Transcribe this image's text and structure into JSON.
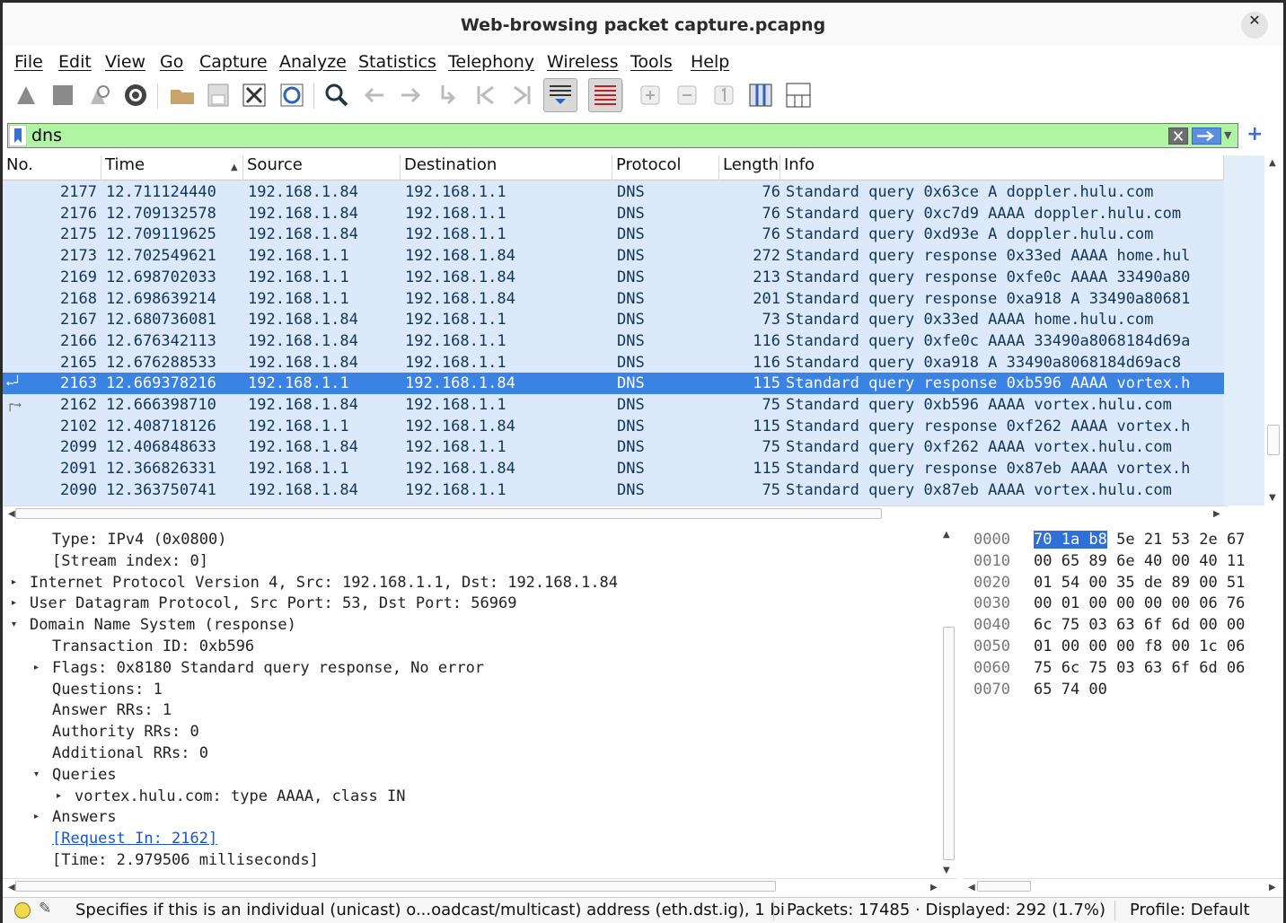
{
  "window": {
    "title": "Web-browsing packet capture.pcapng",
    "close_glyph": "✕"
  },
  "menu": [
    {
      "label": "File"
    },
    {
      "label": "Edit"
    },
    {
      "label": "View"
    },
    {
      "label": "Go"
    },
    {
      "label": "Capture"
    },
    {
      "label": "Analyze"
    },
    {
      "label": "Statistics"
    },
    {
      "label": "Telephony"
    },
    {
      "label": "Wireless"
    },
    {
      "label": "Tools"
    },
    {
      "label": "Help"
    }
  ],
  "toolbar": {
    "icons": [
      "start-capture-icon",
      "stop-capture-icon",
      "restart-capture-icon",
      "capture-options-icon",
      "open-file-icon",
      "save-file-icon",
      "close-file-icon",
      "reload-file-icon",
      "find-packet-icon",
      "go-back-icon",
      "go-forward-icon",
      "go-to-packet-icon",
      "first-packet-icon",
      "last-packet-icon",
      "autoscroll-icon",
      "colorize-icon",
      "zoom-in-icon",
      "zoom-out-icon",
      "normal-size-icon",
      "resize-columns-icon",
      "layout-icon"
    ]
  },
  "filter": {
    "value": "dns",
    "plus": "+"
  },
  "packet_list": {
    "columns": [
      "No.",
      "Time",
      "Source",
      "Destination",
      "Protocol",
      "Length",
      "Info"
    ],
    "rows": [
      {
        "no": "2177",
        "time": "12.711124440",
        "src": "192.168.1.84",
        "dst": "192.168.1.1",
        "proto": "DNS",
        "len": "76",
        "info": "Standard query 0x63ce A doppler.hulu.com"
      },
      {
        "no": "2176",
        "time": "12.709132578",
        "src": "192.168.1.84",
        "dst": "192.168.1.1",
        "proto": "DNS",
        "len": "76",
        "info": "Standard query 0xc7d9 AAAA doppler.hulu.com"
      },
      {
        "no": "2175",
        "time": "12.709119625",
        "src": "192.168.1.84",
        "dst": "192.168.1.1",
        "proto": "DNS",
        "len": "76",
        "info": "Standard query 0xd93e A doppler.hulu.com"
      },
      {
        "no": "2173",
        "time": "12.702549621",
        "src": "192.168.1.1",
        "dst": "192.168.1.84",
        "proto": "DNS",
        "len": "272",
        "info": "Standard query response 0x33ed AAAA home.hul"
      },
      {
        "no": "2169",
        "time": "12.698702033",
        "src": "192.168.1.1",
        "dst": "192.168.1.84",
        "proto": "DNS",
        "len": "213",
        "info": "Standard query response 0xfe0c AAAA 33490a80"
      },
      {
        "no": "2168",
        "time": "12.698639214",
        "src": "192.168.1.1",
        "dst": "192.168.1.84",
        "proto": "DNS",
        "len": "201",
        "info": "Standard query response 0xa918 A 33490a80681"
      },
      {
        "no": "2167",
        "time": "12.680736081",
        "src": "192.168.1.84",
        "dst": "192.168.1.1",
        "proto": "DNS",
        "len": "73",
        "info": "Standard query 0x33ed AAAA home.hulu.com"
      },
      {
        "no": "2166",
        "time": "12.676342113",
        "src": "192.168.1.84",
        "dst": "192.168.1.1",
        "proto": "DNS",
        "len": "116",
        "info": "Standard query 0xfe0c AAAA 33490a8068184d69a"
      },
      {
        "no": "2165",
        "time": "12.676288533",
        "src": "192.168.1.84",
        "dst": "192.168.1.1",
        "proto": "DNS",
        "len": "116",
        "info": "Standard query 0xa918 A 33490a8068184d69ac8"
      },
      {
        "no": "2163",
        "time": "12.669378216",
        "src": "192.168.1.1",
        "dst": "192.168.1.84",
        "proto": "DNS",
        "len": "115",
        "info": "Standard query response 0xb596 AAAA vortex.h",
        "selected": true
      },
      {
        "no": "2162",
        "time": "12.666398710",
        "src": "192.168.1.84",
        "dst": "192.168.1.1",
        "proto": "DNS",
        "len": "75",
        "info": "Standard query 0xb596 AAAA vortex.hulu.com"
      },
      {
        "no": "2102",
        "time": "12.408718126",
        "src": "192.168.1.1",
        "dst": "192.168.1.84",
        "proto": "DNS",
        "len": "115",
        "info": "Standard query response 0xf262 AAAA vortex.h"
      },
      {
        "no": "2099",
        "time": "12.406848633",
        "src": "192.168.1.84",
        "dst": "192.168.1.1",
        "proto": "DNS",
        "len": "75",
        "info": "Standard query 0xf262 AAAA vortex.hulu.com"
      },
      {
        "no": "2091",
        "time": "12.366826331",
        "src": "192.168.1.1",
        "dst": "192.168.1.84",
        "proto": "DNS",
        "len": "115",
        "info": "Standard query response 0x87eb AAAA vortex.h"
      },
      {
        "no": "2090",
        "time": "12.363750741",
        "src": "192.168.1.84",
        "dst": "192.168.1.1",
        "proto": "DNS",
        "len": "75",
        "info": "Standard query 0x87eb AAAA vortex.hulu.com"
      }
    ]
  },
  "detail": {
    "lines": [
      {
        "text": "Type: IPv4 (0x0800)",
        "indent": 2,
        "tri": ""
      },
      {
        "text": "[Stream index: 0]",
        "indent": 2,
        "tri": ""
      },
      {
        "text": "Internet Protocol Version 4, Src: 192.168.1.1, Dst: 192.168.1.84",
        "indent": 1,
        "tri": "▸"
      },
      {
        "text": "User Datagram Protocol, Src Port: 53, Dst Port: 56969",
        "indent": 1,
        "tri": "▸"
      },
      {
        "text": "Domain Name System (response)",
        "indent": 1,
        "tri": "▾"
      },
      {
        "text": "Transaction ID: 0xb596",
        "indent": 2,
        "tri": ""
      },
      {
        "text": "Flags: 0x8180 Standard query response, No error",
        "indent": 2,
        "tri": "▸"
      },
      {
        "text": "Questions: 1",
        "indent": 2,
        "tri": ""
      },
      {
        "text": "Answer RRs: 1",
        "indent": 2,
        "tri": ""
      },
      {
        "text": "Authority RRs: 0",
        "indent": 2,
        "tri": ""
      },
      {
        "text": "Additional RRs: 0",
        "indent": 2,
        "tri": ""
      },
      {
        "text": "Queries",
        "indent": 2,
        "tri": "▾"
      },
      {
        "text": "vortex.hulu.com: type AAAA, class IN",
        "indent": 3,
        "tri": "▸"
      },
      {
        "text": "Answers",
        "indent": 2,
        "tri": "▸"
      },
      {
        "text": "[Request In: 2162]",
        "indent": 2,
        "tri": "",
        "link": true
      },
      {
        "text": "[Time: 2.979506 milliseconds]",
        "indent": 2,
        "tri": ""
      }
    ]
  },
  "bytes": {
    "rows": [
      {
        "offset": "0000",
        "hl": "70 1a b8",
        "rest": " 5e 21 53 2e 67"
      },
      {
        "offset": "0010",
        "hl": "",
        "rest": "00 65 89 6e 40 00 40 11"
      },
      {
        "offset": "0020",
        "hl": "",
        "rest": "01 54 00 35 de 89 00 51"
      },
      {
        "offset": "0030",
        "hl": "",
        "rest": "00 01 00 00 00 00 06 76"
      },
      {
        "offset": "0040",
        "hl": "",
        "rest": "6c 75 03 63 6f 6d 00 00"
      },
      {
        "offset": "0050",
        "hl": "",
        "rest": "01 00 00 00 f8 00 1c 06"
      },
      {
        "offset": "0060",
        "hl": "",
        "rest": "75 6c 75 03 63 6f 6d 06"
      },
      {
        "offset": "0070",
        "hl": "",
        "rest": "65 74 00"
      }
    ]
  },
  "status": {
    "message": "Specifies if this is an individual (unicast) o...oadcast/multicast) address (eth.dst.ig), 1 bi",
    "packets": "Packets: 17485 · Displayed: 292 (1.7%)",
    "profile": "Profile: Default"
  },
  "colors": {
    "filter_bg": "#b0f5a4",
    "selected_row": "#3a82e4",
    "list_bg": "#dbe9fb",
    "link": "#1a55d6"
  }
}
